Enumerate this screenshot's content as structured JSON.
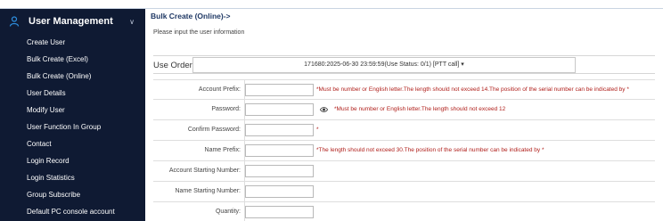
{
  "sidebar": {
    "title": "User Management",
    "items": [
      {
        "label": "Create User"
      },
      {
        "label": "Bulk Create (Excel)"
      },
      {
        "label": "Bulk Create (Online)"
      },
      {
        "label": "User Details"
      },
      {
        "label": "Modify User"
      },
      {
        "label": "User Function In Group"
      },
      {
        "label": "Contact"
      },
      {
        "label": "Login Record"
      },
      {
        "label": "Login Statistics"
      },
      {
        "label": "Group Subscribe"
      },
      {
        "label": "Default PC console account"
      }
    ]
  },
  "main": {
    "breadcrumb": "Bulk Create (Online)->",
    "subtitle": "Please input the user information",
    "use_order": {
      "label": "Use Order:",
      "value": "171680:2025-06-30 23:59:59(Use Status:  0/1) [PTT call] ▾"
    },
    "form": {
      "account_prefix": {
        "label": "Account Prefix:",
        "hint": "*Must be number or English letter.The length should not exceed 14.The position of the serial number can be indicated by *"
      },
      "password": {
        "label": "Password:",
        "hint": "*Must be number or English letter.The length should not exceed 12"
      },
      "confirm_password": {
        "label": "Confirm Password:",
        "hint": "*"
      },
      "name_prefix": {
        "label": "Name Prefix:",
        "hint": "*The length should not exceed 30.The position of the serial number can be indicated by *"
      },
      "account_starting_number": {
        "label": "Account Starting Number:"
      },
      "name_starting_number": {
        "label": "Name Starting Number:"
      },
      "quantity": {
        "label": "Quantity:"
      }
    }
  },
  "colors": {
    "sidebar_bg": "#0f1a33",
    "breadcrumb": "#1f3864",
    "hint_red": "#b0201c",
    "user_icon": "#2e8fe0"
  }
}
